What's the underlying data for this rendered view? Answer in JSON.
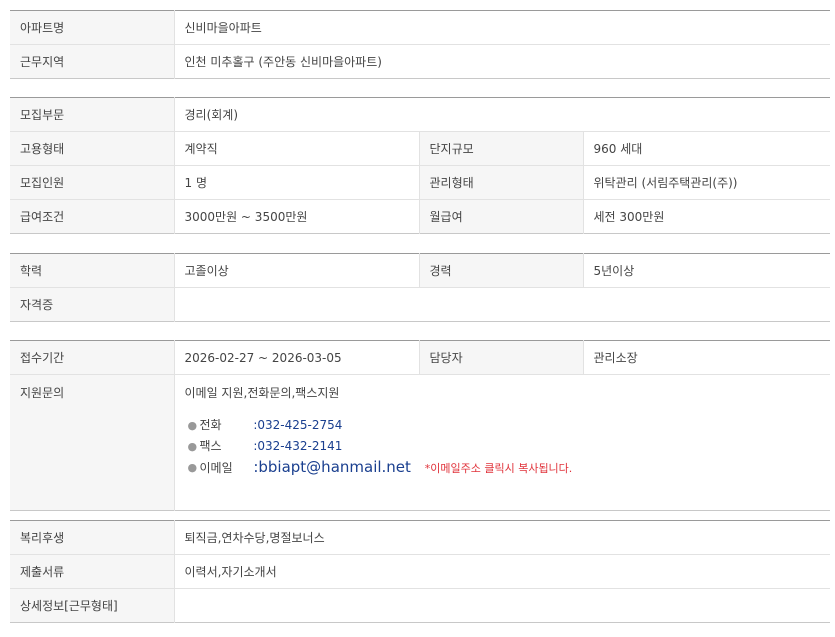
{
  "section1": {
    "rows": [
      {
        "label": "아파트명",
        "value": "신비마을아파트"
      },
      {
        "label": "근무지역",
        "value": "인천  미추홀구 (주안동 신비마을아파트)"
      }
    ]
  },
  "section2": {
    "dept_label": "모집부문",
    "dept_value": "경리(회계)",
    "emp_type_label": "고용형태",
    "emp_type_value": "계약직",
    "complex_size_label": "단지규모",
    "complex_size_value": "960 세대",
    "headcount_label": "모집인원",
    "headcount_value": "1 명",
    "mgmt_type_label": "관리형태",
    "mgmt_type_value": "위탁관리 (서림주택관리(주))",
    "salary_label": "급여조건",
    "salary_value": "3000만원 ~ 3500만원",
    "monthly_label": "월급여",
    "monthly_value": "세전 300만원"
  },
  "section3": {
    "edu_label": "학력",
    "edu_value": "고졸이상",
    "exp_label": "경력",
    "exp_value": "5년이상",
    "cert_label": "자격증",
    "cert_value": ""
  },
  "section4": {
    "period_label": "접수기간",
    "period_value": "2026-02-27 ~ 2026-03-05",
    "manager_label": "담당자",
    "manager_value": "관리소장",
    "inquiry_label": "지원문의",
    "inquiry_methods": "이메일 지원,전화문의,팩스지원",
    "contacts": {
      "phone_label": "전화",
      "phone_value": ":032-425-2754",
      "fax_label": "팩스",
      "fax_value": ":032-432-2141",
      "email_label": "이메일",
      "email_value": ":bbiapt@hanmail.net",
      "email_note": "*이메일주소 클릭시 복사됩니다."
    }
  },
  "section5": {
    "welfare_label": "복리후생",
    "welfare_value": "퇴직금,연차수당,명절보너스",
    "docs_label": "제출서류",
    "docs_value": "이력서,자기소개서",
    "detail_label": "상세정보[근무형태]",
    "detail_value": ""
  }
}
